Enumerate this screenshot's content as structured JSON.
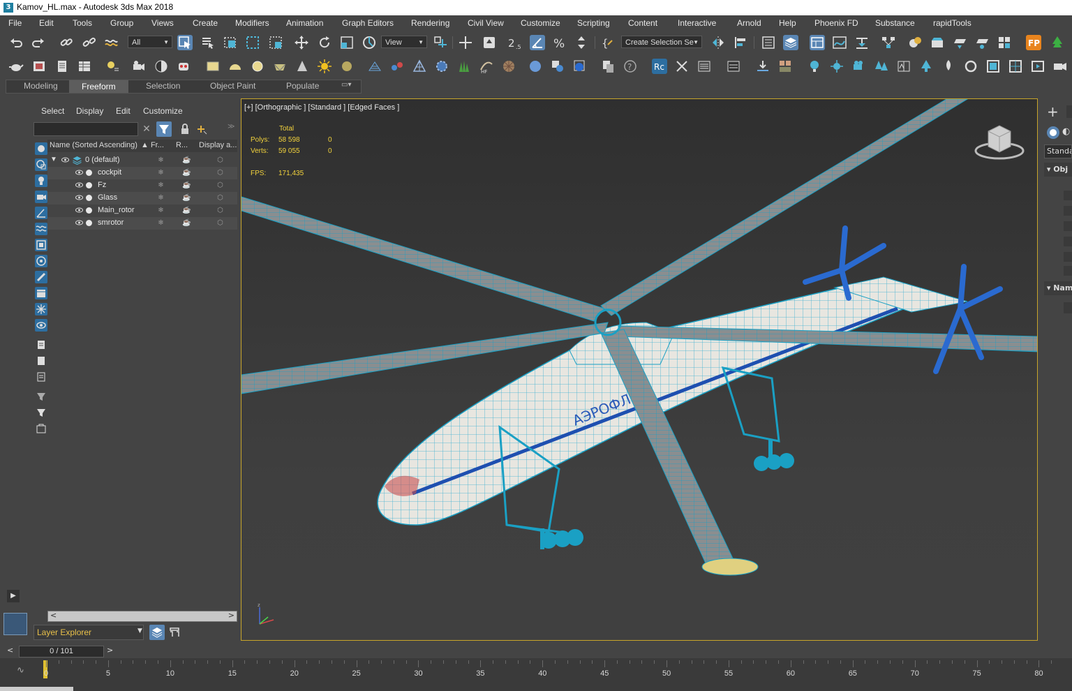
{
  "window": {
    "title": "Kamov_HL.max - Autodesk 3ds Max 2018",
    "app_icon": "3"
  },
  "menu": [
    "File",
    "Edit",
    "Tools",
    "Group",
    "Views",
    "Create",
    "Modifiers",
    "Animation",
    "Graph Editors",
    "Rendering",
    "Civil View",
    "Customize",
    "Scripting",
    "Content",
    "Interactive",
    "Arnold",
    "Help",
    "Phoenix FD",
    "Substance",
    "rapidTools"
  ],
  "toolbar": {
    "filter_value": "All",
    "coord_value": "View",
    "angle_snap_label": "2",
    "selection_set_placeholder": "Create Selection Se"
  },
  "ribbon": {
    "tabs": [
      "Modeling",
      "Freeform",
      "Selection",
      "Object Paint",
      "Populate"
    ],
    "active": "Freeform"
  },
  "scene_explorer": {
    "menus": [
      "Select",
      "Display",
      "Edit",
      "Customize"
    ],
    "columns": [
      "Name (Sorted Ascending)",
      "▲ Fr...",
      "R...",
      "Display a..."
    ],
    "root": "0 (default)",
    "objects": [
      "cockpit",
      "Fz",
      "Glass",
      "Main_rotor",
      "smrotor"
    ],
    "layer_dropdown": "Layer Explorer"
  },
  "viewport": {
    "label": "[+] [Orthographic ] [Standard ] [Edged Faces ]",
    "stats": {
      "total_label": "Total",
      "polys_label": "Polys:",
      "polys_total": "58 598",
      "polys_sel": "0",
      "verts_label": "Verts:",
      "verts_total": "59 055",
      "verts_sel": "0",
      "fps_label": "FPS:",
      "fps_value": "171,435"
    },
    "fuselage_text": "АЭРОФЛ"
  },
  "command_panel": {
    "dropdown": "Standa",
    "rollout1": "Obj",
    "rollout2": "Nam"
  },
  "timeline": {
    "slider_label": "0 / 101",
    "ticks": [
      "0",
      "5",
      "10",
      "15",
      "20",
      "25",
      "30",
      "35",
      "40",
      "45",
      "50",
      "55",
      "60",
      "65",
      "70",
      "75",
      "80"
    ]
  },
  "colors": {
    "accent_blue": "#5a86b4",
    "viewport_border": "#c8a52a",
    "stats_yellow": "#f2d23c",
    "wire_cyan": "#1aa0c4"
  }
}
